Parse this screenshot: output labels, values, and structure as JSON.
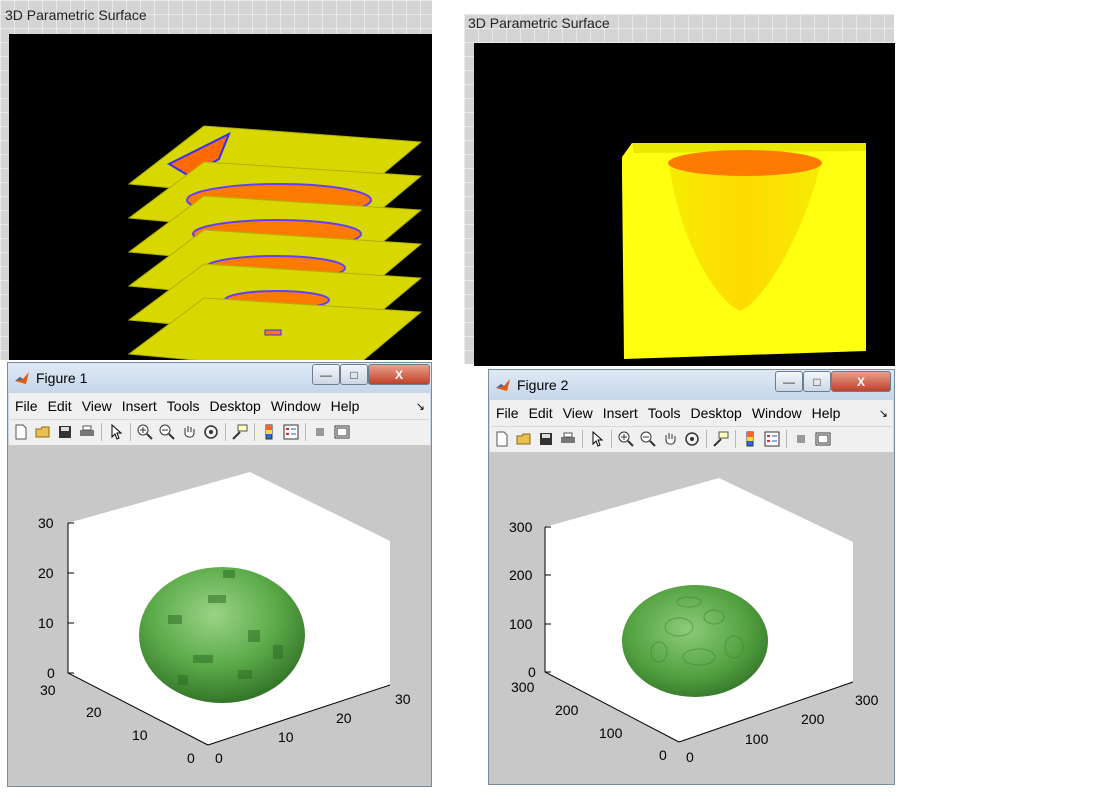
{
  "panels": [
    {
      "title": "3D Parametric Surface"
    },
    {
      "title": "3D Parametric Surface"
    }
  ],
  "figures": [
    {
      "title": "Figure 1",
      "menu": [
        "File",
        "Edit",
        "View",
        "Insert",
        "Tools",
        "Desktop",
        "Window",
        "Help"
      ],
      "menu_overflow": "↘",
      "z_ticks": [
        "30",
        "20",
        "10",
        "0"
      ],
      "left_ticks": [
        "30",
        "20",
        "10",
        "0"
      ],
      "right_ticks": [
        "0",
        "10",
        "20",
        "30"
      ]
    },
    {
      "title": "Figure 2",
      "menu": [
        "File",
        "Edit",
        "View",
        "Insert",
        "Tools",
        "Desktop",
        "Window",
        "Help"
      ],
      "menu_overflow": "↘",
      "z_ticks": [
        "300",
        "200",
        "100",
        "0"
      ],
      "left_ticks": [
        "300",
        "200",
        "100",
        "0"
      ],
      "right_ticks": [
        "0",
        "100",
        "200",
        "300"
      ]
    }
  ],
  "window_buttons": {
    "minimize": "—",
    "maximize": "□",
    "close": "X"
  },
  "colors": {
    "surface_yellow": "#e8e800",
    "surface_orange": "#ff7a00",
    "blob_green": "#5aaa48",
    "matlab_gray": "#c8c8c8"
  },
  "toolbar_icons": [
    "new-file-icon",
    "open-folder-icon",
    "save-icon",
    "print-icon",
    "pointer-icon",
    "zoom-in-icon",
    "zoom-out-icon",
    "pan-hand-icon",
    "rotate-3d-icon",
    "data-cursor-icon",
    "colorbar-icon",
    "legend-icon",
    "hide-plot-tools-icon",
    "show-plot-tools-icon"
  ]
}
